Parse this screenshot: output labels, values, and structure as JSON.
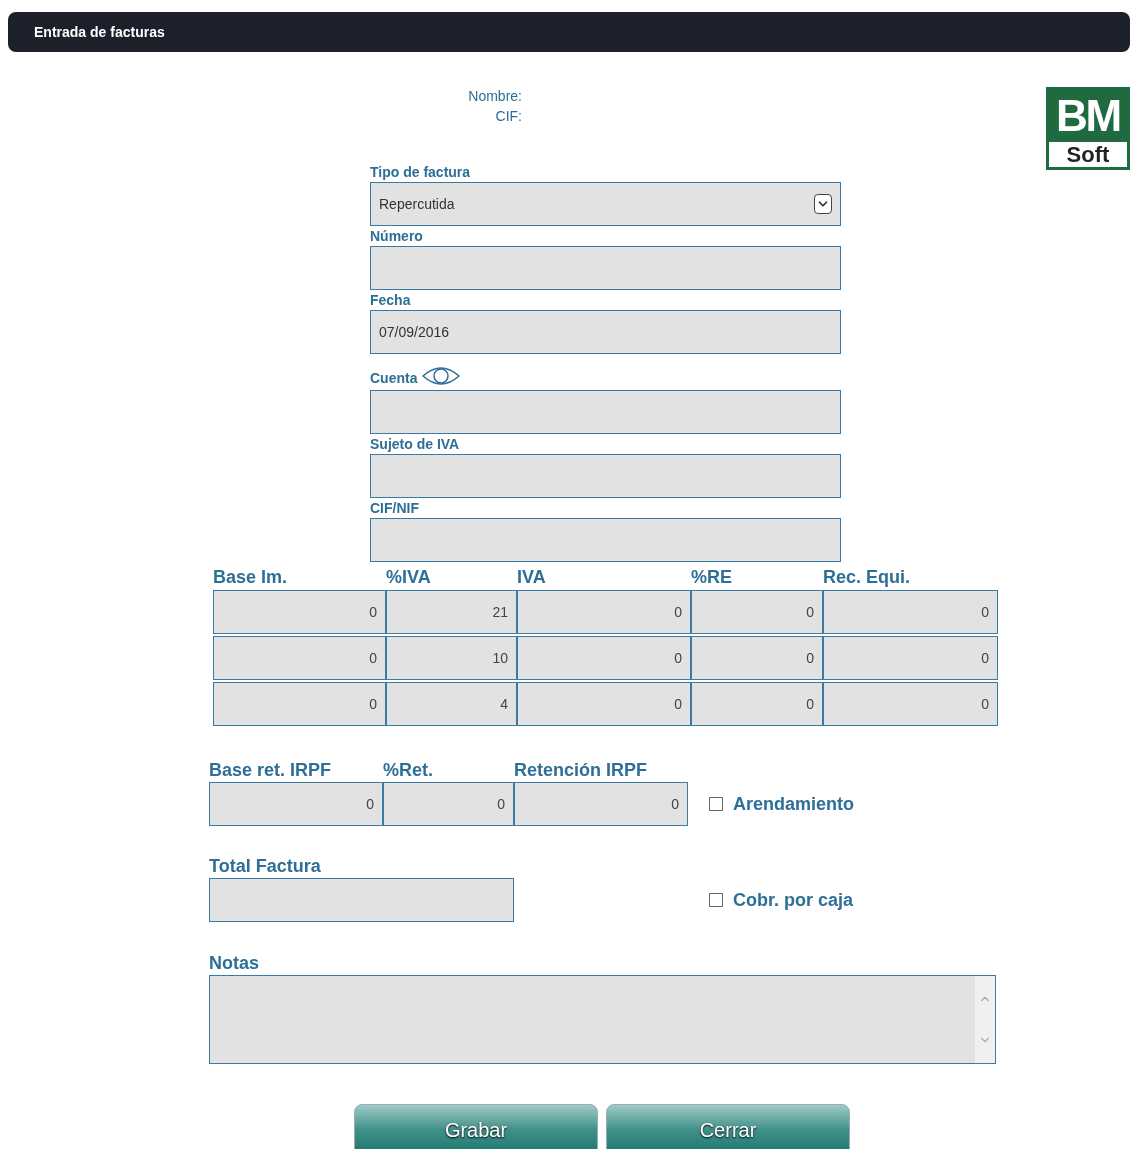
{
  "window": {
    "title": "Entrada de facturas"
  },
  "company": {
    "name_label": "Nombre:",
    "cif_label": "CIF:"
  },
  "logo": {
    "top": "BM",
    "bottom": "Soft"
  },
  "fields": [
    {
      "label": "Tipo de factura",
      "kind": "select",
      "value": "Repercutida"
    },
    {
      "label": "Número",
      "kind": "text"
    },
    {
      "label": "Fecha",
      "kind": "text",
      "value": "07/09/2016"
    },
    {
      "label": "Cuenta",
      "kind": "lookup"
    },
    {
      "label": "Sujeto de IVA",
      "kind": "text"
    },
    {
      "label": "CIF/NIF",
      "kind": "text"
    }
  ],
  "vat_table": {
    "columns": [
      "Base Im.",
      "%IVA",
      "IVA",
      "%RE",
      "Rec. Equi."
    ],
    "rows": [
      [
        "0",
        "21",
        "0",
        "0",
        "0"
      ],
      [
        "0",
        "10",
        "0",
        "0",
        "0"
      ],
      [
        "0",
        "4",
        "0",
        "0",
        "0"
      ]
    ]
  },
  "irpf": {
    "columns": [
      "Base ret. IRPF",
      "%Ret.",
      "Retención IRPF"
    ],
    "values": [
      "0",
      "0",
      "0"
    ]
  },
  "options": [
    {
      "label": "Arendamiento",
      "checked": false
    },
    {
      "label": "Cobr. por caja",
      "checked": false
    }
  ],
  "total": {
    "label": "Total Factura"
  },
  "notes": {
    "label": "Notas"
  },
  "buttons": [
    "Grabar",
    "Cerrar"
  ]
}
